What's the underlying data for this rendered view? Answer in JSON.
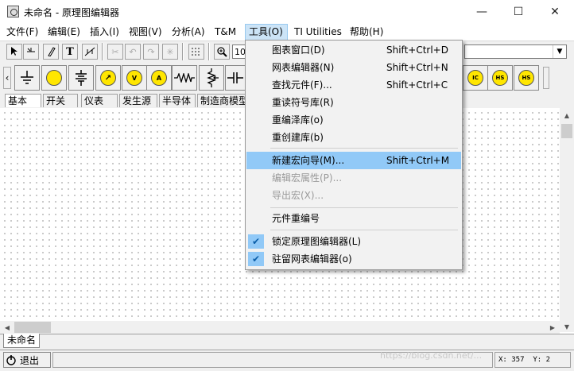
{
  "window": {
    "title": "未命名 - 原理图编辑器",
    "minimize": "—",
    "maximize": "☐",
    "close": "✕"
  },
  "menubar": {
    "items": [
      {
        "label": "文件(F)"
      },
      {
        "label": "编辑(E)"
      },
      {
        "label": "插入(I)"
      },
      {
        "label": "视图(V)"
      },
      {
        "label": "分析(A)"
      },
      {
        "label": "T&M"
      },
      {
        "label": "工具(O)",
        "active": true
      },
      {
        "label": "TI Utilities"
      },
      {
        "label": "帮助(H)"
      }
    ]
  },
  "toolbar": {
    "zoom_value": "10",
    "arrow_glyph": "▼"
  },
  "component_tabs": [
    {
      "label": "基本",
      "selected": true
    },
    {
      "label": "开关"
    },
    {
      "label": "仪表"
    },
    {
      "label": "发生源"
    },
    {
      "label": "半导体"
    },
    {
      "label": "制造商模型"
    }
  ],
  "palette_icons": {
    "voltmeter": "V",
    "ammeter": "A",
    "ic": "IC",
    "hs1": "HS",
    "hs2": "HS"
  },
  "tools_menu": {
    "items": [
      {
        "label": "图表窗口(D)",
        "shortcut": "Shift+Ctrl+D"
      },
      {
        "label": "网表编辑器(N)",
        "shortcut": "Shift+Ctrl+N"
      },
      {
        "label": "查找元件(F)...",
        "shortcut": "Shift+Ctrl+C"
      },
      {
        "label": "重读符号库(R)",
        "shortcut": ""
      },
      {
        "label": "重编泽库(o)",
        "shortcut": ""
      },
      {
        "label": "重创建库(b)",
        "shortcut": ""
      },
      {
        "label": "新建宏向导(M)...",
        "shortcut": "Shift+Ctrl+M",
        "highlighted": true
      },
      {
        "label": "编辑宏属性(P)...",
        "shortcut": "",
        "disabled": true
      },
      {
        "label": "导出宏(X)...",
        "shortcut": "",
        "disabled": true
      },
      {
        "label": "元件重编号",
        "shortcut": ""
      },
      {
        "label": "锁定原理图编辑器(L)",
        "shortcut": "",
        "checked": true
      },
      {
        "label": "驻留网表编辑器(o)",
        "shortcut": "",
        "checked": true
      }
    ],
    "check_glyph": "✔"
  },
  "sheet_tab": {
    "label": "未命名"
  },
  "statusbar": {
    "exit_label": "退出",
    "coords": "X: 357  Y: 2",
    "watermark": "https://blog.csdn.net/..."
  }
}
